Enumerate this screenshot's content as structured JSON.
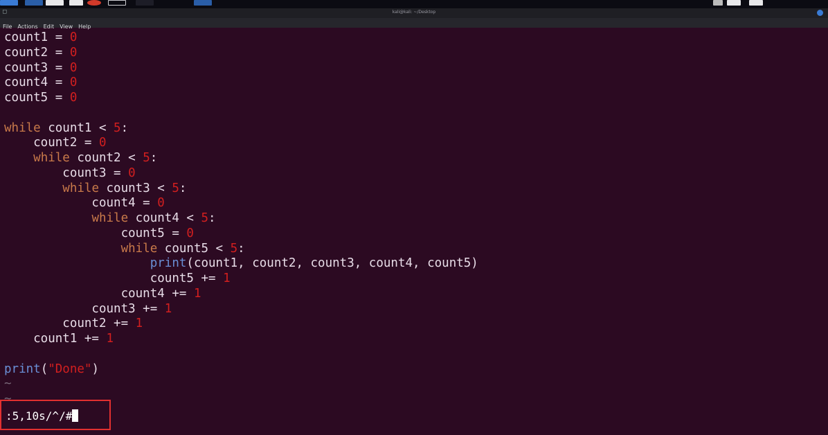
{
  "window": {
    "title": "kali@kali: ~/Desktop",
    "menu": [
      "File",
      "Actions",
      "Edit",
      "View",
      "Help"
    ]
  },
  "code_lines": [
    [
      {
        "t": "count1 = ",
        "c": "plain"
      },
      {
        "t": "0",
        "c": "num"
      }
    ],
    [
      {
        "t": "count2 = ",
        "c": "plain"
      },
      {
        "t": "0",
        "c": "num"
      }
    ],
    [
      {
        "t": "count3 = ",
        "c": "plain"
      },
      {
        "t": "0",
        "c": "num"
      }
    ],
    [
      {
        "t": "count4 = ",
        "c": "plain"
      },
      {
        "t": "0",
        "c": "num"
      }
    ],
    [
      {
        "t": "count5 = ",
        "c": "plain"
      },
      {
        "t": "0",
        "c": "num"
      }
    ],
    [],
    [
      {
        "t": "while",
        "c": "kw"
      },
      {
        "t": " count1 < ",
        "c": "plain"
      },
      {
        "t": "5",
        "c": "num"
      },
      {
        "t": ":",
        "c": "plain"
      }
    ],
    [
      {
        "t": "    count2 = ",
        "c": "plain"
      },
      {
        "t": "0",
        "c": "num"
      }
    ],
    [
      {
        "t": "    ",
        "c": "plain"
      },
      {
        "t": "while",
        "c": "kw"
      },
      {
        "t": " count2 < ",
        "c": "plain"
      },
      {
        "t": "5",
        "c": "num"
      },
      {
        "t": ":",
        "c": "plain"
      }
    ],
    [
      {
        "t": "        count3 = ",
        "c": "plain"
      },
      {
        "t": "0",
        "c": "num"
      }
    ],
    [
      {
        "t": "        ",
        "c": "plain"
      },
      {
        "t": "while",
        "c": "kw"
      },
      {
        "t": " count3 < ",
        "c": "plain"
      },
      {
        "t": "5",
        "c": "num"
      },
      {
        "t": ":",
        "c": "plain"
      }
    ],
    [
      {
        "t": "            count4 = ",
        "c": "plain"
      },
      {
        "t": "0",
        "c": "num"
      }
    ],
    [
      {
        "t": "            ",
        "c": "plain"
      },
      {
        "t": "while",
        "c": "kw"
      },
      {
        "t": " count4 < ",
        "c": "plain"
      },
      {
        "t": "5",
        "c": "num"
      },
      {
        "t": ":",
        "c": "plain"
      }
    ],
    [
      {
        "t": "                count5 = ",
        "c": "plain"
      },
      {
        "t": "0",
        "c": "num"
      }
    ],
    [
      {
        "t": "                ",
        "c": "plain"
      },
      {
        "t": "while",
        "c": "kw"
      },
      {
        "t": " count5 < ",
        "c": "plain"
      },
      {
        "t": "5",
        "c": "num"
      },
      {
        "t": ":",
        "c": "plain"
      }
    ],
    [
      {
        "t": "                    ",
        "c": "plain"
      },
      {
        "t": "print",
        "c": "fn"
      },
      {
        "t": "(count1, count2, count3, count4, count5)",
        "c": "plain"
      }
    ],
    [
      {
        "t": "                    count5 += ",
        "c": "plain"
      },
      {
        "t": "1",
        "c": "num"
      }
    ],
    [
      {
        "t": "                count4 += ",
        "c": "plain"
      },
      {
        "t": "1",
        "c": "num"
      }
    ],
    [
      {
        "t": "            count3 += ",
        "c": "plain"
      },
      {
        "t": "1",
        "c": "num"
      }
    ],
    [
      {
        "t": "        count2 += ",
        "c": "plain"
      },
      {
        "t": "1",
        "c": "num"
      }
    ],
    [
      {
        "t": "    count1 += ",
        "c": "plain"
      },
      {
        "t": "1",
        "c": "num"
      }
    ],
    [],
    [
      {
        "t": "print",
        "c": "fn"
      },
      {
        "t": "(",
        "c": "plain"
      },
      {
        "t": "\"Done\"",
        "c": "str"
      },
      {
        "t": ")",
        "c": "plain"
      }
    ],
    [
      {
        "t": "~",
        "c": "tilde"
      }
    ],
    [
      {
        "t": "~",
        "c": "tilde"
      }
    ]
  ],
  "command": {
    "text": ":5,10s/^/#"
  },
  "colors": {
    "background": "#2c0a22",
    "keyword": "#c97a4a",
    "number": "#d21f1f",
    "function": "#6a8fd6",
    "highlight_box": "#e23030"
  }
}
